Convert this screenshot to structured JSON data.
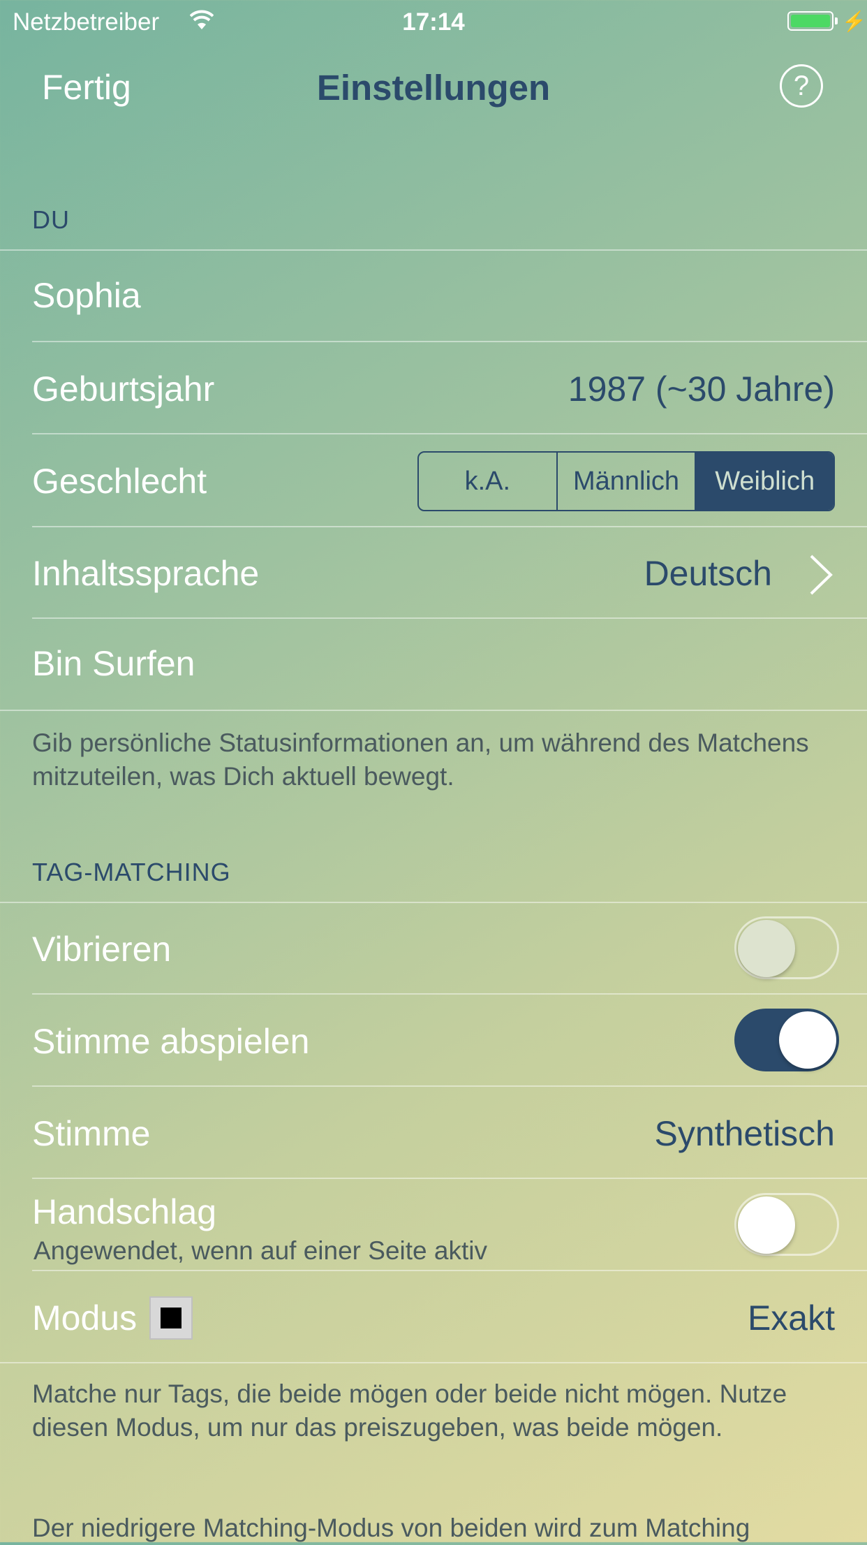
{
  "status_bar": {
    "carrier": "Netzbetreiber",
    "time": "17:14",
    "battery_color": "#4cd964"
  },
  "nav": {
    "done_label": "Fertig",
    "title": "Einstellungen",
    "help_label": "?"
  },
  "sections": {
    "you": {
      "header": "DU",
      "name": "Sophia",
      "birth_year_label": "Geburtsjahr",
      "birth_year_value": "1987 (~30 Jahre)",
      "gender_label": "Geschlecht",
      "gender_options": [
        "k.A.",
        "Männlich",
        "Weiblich"
      ],
      "gender_selected": "Weiblich",
      "language_label": "Inhaltssprache",
      "language_value": "Deutsch",
      "status_text": "Bin Surfen",
      "footer": "Gib persönliche Statusinformationen an, um während des Matchens mitzuteilen, was Dich aktuell bewegt."
    },
    "tag_matching": {
      "header": "TAG-MATCHING",
      "vibrate_label": "Vibrieren",
      "vibrate_on": false,
      "play_voice_label": "Stimme abspielen",
      "play_voice_on": true,
      "voice_label": "Stimme",
      "voice_value": "Synthetisch",
      "handshake_label": "Handschlag",
      "handshake_sub": "Angewendet, wenn auf einer Seite aktiv",
      "handshake_on": false,
      "mode_label": "Modus",
      "mode_value": "Exakt",
      "footer_1": "Matche nur Tags, die beide mögen oder beide nicht mögen. Nutze diesen Modus, um nur das preiszugeben, was beide mögen.",
      "footer_2": "Der niedrigere Matching-Modus von beiden wird zum Matching"
    }
  },
  "colors": {
    "accent": "#2b4a6b",
    "label": "#ffffff",
    "footer": "#4a5a5e"
  }
}
